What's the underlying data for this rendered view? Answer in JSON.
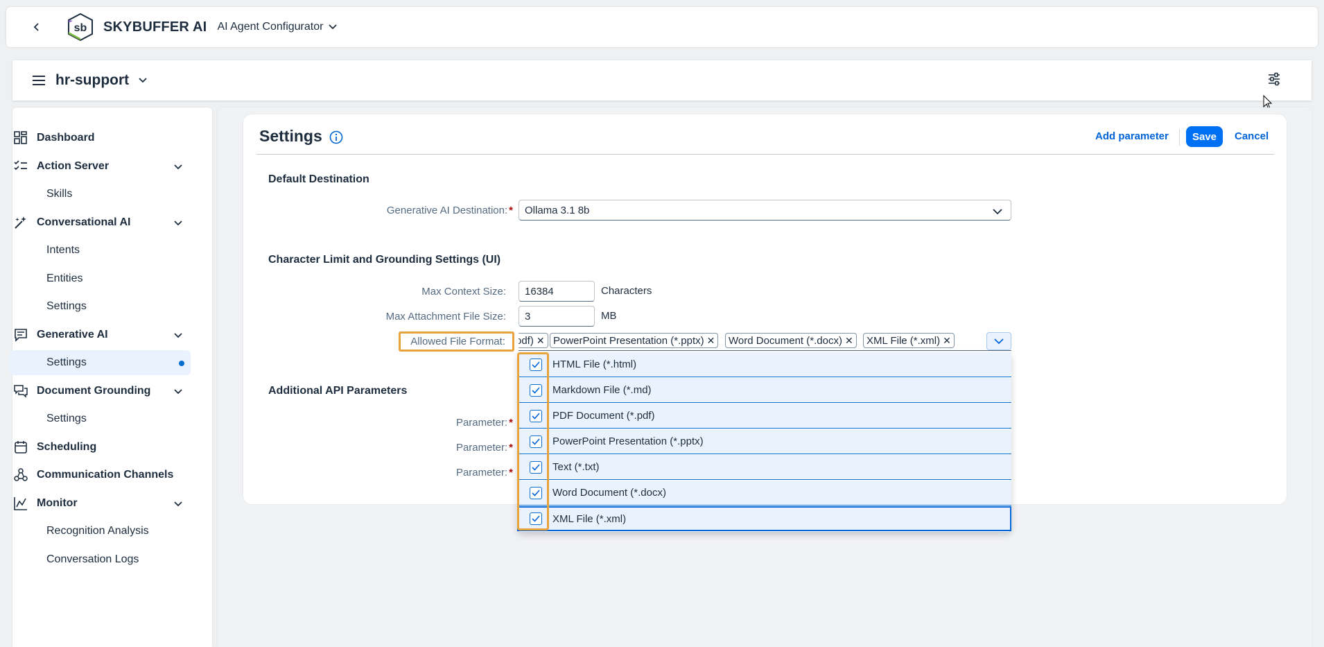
{
  "shell": {
    "brand": "SKYBUFFER AI",
    "app_name": "AI Agent Configurator",
    "logo_text": "sb"
  },
  "header": {
    "title": "hr-support"
  },
  "sidebar": {
    "items": [
      {
        "label": "Dashboard",
        "icon": "dashboard-icon"
      },
      {
        "label": "Action Server",
        "icon": "checklist-icon"
      },
      {
        "label": "Skills"
      },
      {
        "label": "Conversational AI",
        "icon": "magic-wand-icon"
      },
      {
        "label": "Intents"
      },
      {
        "label": "Entities"
      },
      {
        "label": "Settings"
      },
      {
        "label": "Generative AI",
        "icon": "message-icon"
      },
      {
        "label": "Settings"
      },
      {
        "label": "Document Grounding",
        "icon": "discussion-icon"
      },
      {
        "label": "Settings"
      },
      {
        "label": "Scheduling",
        "icon": "calendar-icon"
      },
      {
        "label": "Communication Channels",
        "icon": "share-icon"
      },
      {
        "label": "Monitor",
        "icon": "line-chart-icon"
      },
      {
        "label": "Recognition Analysis"
      },
      {
        "label": "Conversation Logs"
      }
    ]
  },
  "page": {
    "title": "Settings",
    "add_parameter": "Add parameter",
    "save": "Save",
    "cancel": "Cancel"
  },
  "default_destination": {
    "section_title": "Default Destination",
    "label": "Generative AI Destination:",
    "value": "Ollama 3.1 8b"
  },
  "char_limits": {
    "section_title": "Character Limit and Grounding Settings (UI)",
    "max_context_label": "Max Context Size:",
    "max_context_value": "16384",
    "max_context_unit": "Characters",
    "max_attach_label": "Max Attachment File Size:",
    "max_attach_value": "3",
    "max_attach_unit": "MB",
    "allowed_label": "Allowed File Format:",
    "tokens": [
      "odf)",
      "PowerPoint Presentation (*.pptx)",
      "Word Document (*.docx)",
      "XML File (*.xml)"
    ],
    "options": [
      {
        "label": "HTML File (*.html)",
        "checked": true
      },
      {
        "label": "Markdown File (*.md)",
        "checked": true
      },
      {
        "label": "PDF Document (*.pdf)",
        "checked": true
      },
      {
        "label": "PowerPoint Presentation (*.pptx)",
        "checked": true
      },
      {
        "label": "Text (*.txt)",
        "checked": true
      },
      {
        "label": "Word Document (*.docx)",
        "checked": true
      },
      {
        "label": "XML File (*.xml)",
        "checked": true
      }
    ]
  },
  "api_params": {
    "section_title": "Additional API Parameters",
    "param_label": "Parameter:"
  },
  "colors": {
    "accent": "#0070f2",
    "highlight": "#e8a33d",
    "required": "#aa0808"
  }
}
